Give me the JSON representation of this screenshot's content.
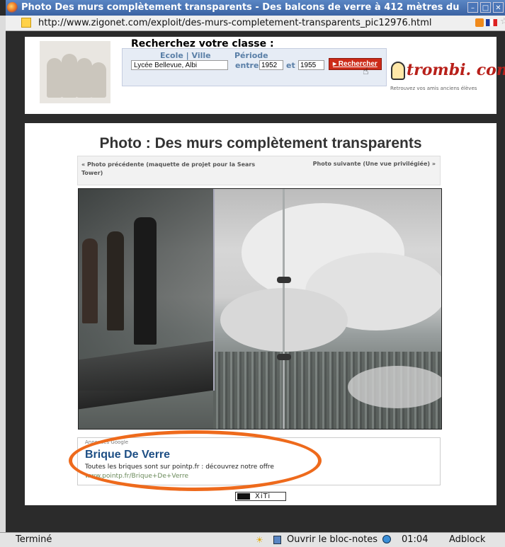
{
  "window": {
    "title": "Photo Des murs complètement transparents - Des balcons de verre à 412 mètres du",
    "min_btn": "–",
    "max_btn": "□",
    "close_btn": "✕"
  },
  "urlbar": {
    "url": "http://www.zigonet.com/exploit/des-murs-completement-transparents_pic12976.html"
  },
  "banner": {
    "search_title": "Recherchez votre classe :",
    "school_label": "Ecole  |  Ville",
    "period_label": "Période",
    "school_value": "Lycée Bellevue, Albi",
    "between_label": "entre",
    "year_from": "1952",
    "and_label": "et",
    "year_to": "1955",
    "search_button": "▸ Rechercher",
    "logo_text": "trombi. com",
    "logo_tagline": "Retrouvez vos amis anciens élèves"
  },
  "main": {
    "page_title": "Photo : Des murs complètement transparents",
    "prev_link": "« Photo précédente (maquette de projet pour la Sears Tower)",
    "next_link": "Photo suivante (Une vue privilégiée) »"
  },
  "ad": {
    "label": "Annonces Google",
    "title": "Brique De Verre",
    "description": "Toutes les briques sont sur pointp.fr : découvrez notre offre",
    "url": "www.pointp.fr/Brique+De+Verre"
  },
  "xiti": {
    "label": "XiTi"
  },
  "statusbar": {
    "status": "Terminé",
    "notepad": "Ouvrir le bloc-notes",
    "time": "01:04",
    "adblock": "Adblock"
  },
  "colors": {
    "titlebar": "#3b63a3",
    "search_button": "#cc2a18",
    "ad_title": "#1d4e84",
    "highlight_oval": "#ee6a1c",
    "logo": "#b8201a"
  }
}
